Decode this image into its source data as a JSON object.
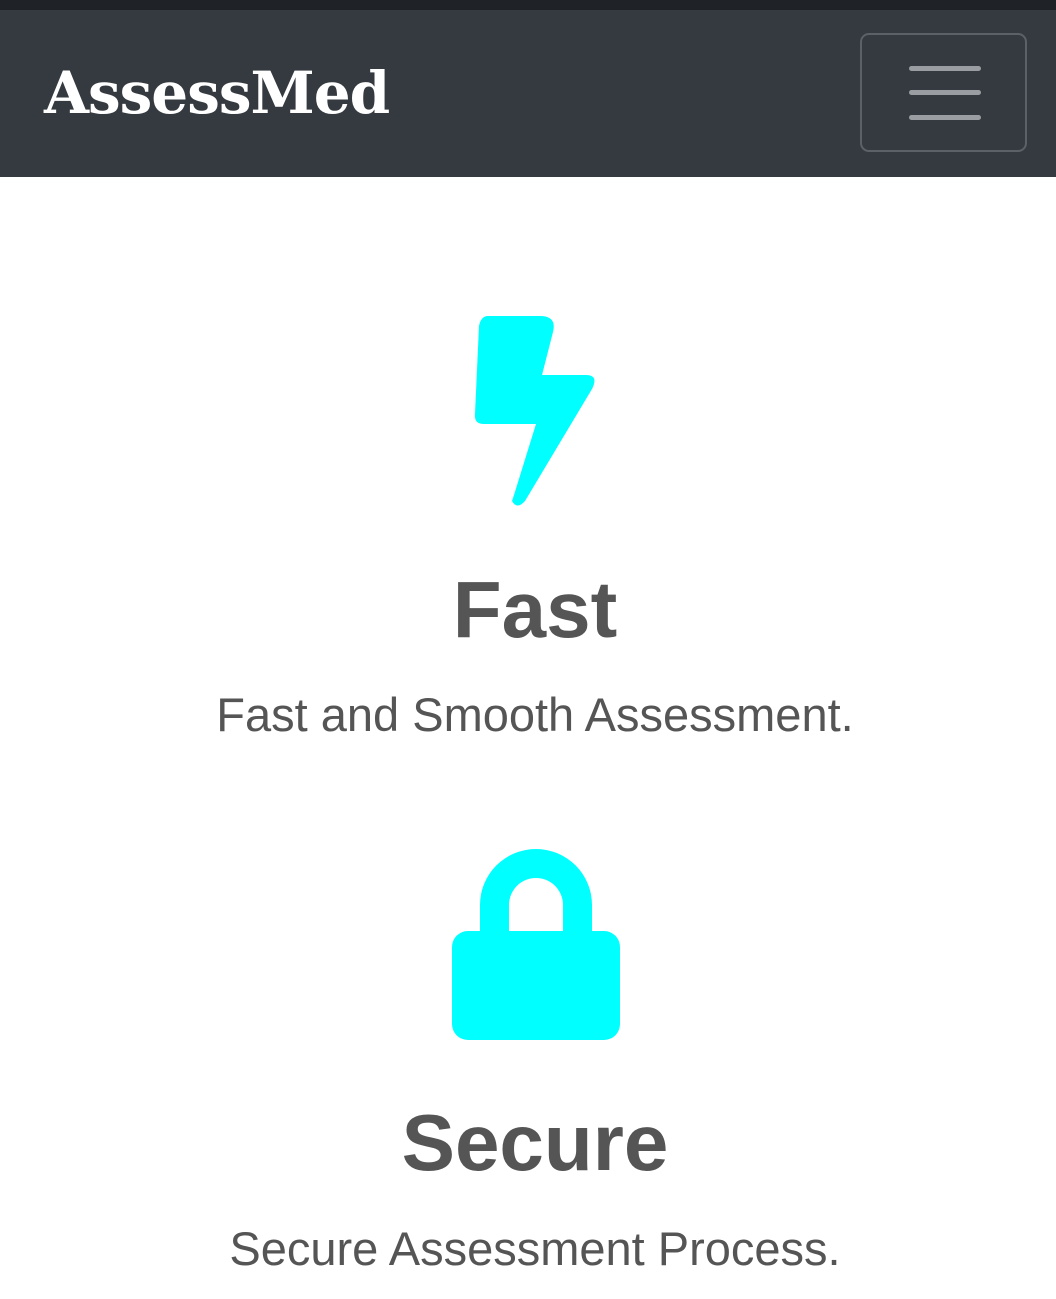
{
  "navbar": {
    "brand": "AssessMed",
    "menu_icon": "hamburger-menu-icon"
  },
  "features": [
    {
      "icon": "lightning-bolt-icon",
      "title": "Fast",
      "description": "Fast and Smooth Assessment."
    },
    {
      "icon": "lock-icon",
      "title": "Secure",
      "description": "Secure Assessment Process."
    }
  ],
  "colors": {
    "navbar_bg": "#343a40",
    "accent_icon": "#00ffff",
    "text": "#555555"
  }
}
